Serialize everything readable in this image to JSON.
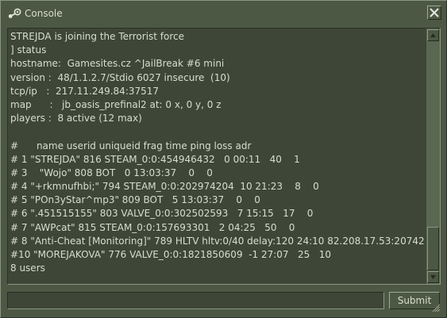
{
  "window": {
    "title": "Console",
    "colors": {
      "background": "#4c5844",
      "console_background": "#3e4637",
      "text": "#d8decf"
    }
  },
  "icons": {
    "title": "steam-icon",
    "close": "close-icon",
    "scroll_up": "arrow-up-icon",
    "scroll_down": "arrow-down-icon",
    "resize": "resize-grip-icon"
  },
  "console": {
    "lines": [
      "STREJDA is joining the Terrorist force",
      "] status",
      "hostname:  Gamesites.cz ^JailBreak #6 mini",
      "version :  48/1.1.2.7/Stdio 6027 insecure  (10)",
      "tcp/ip   :  217.11.249.84:37517",
      "map      :   jb_oasis_prefinal2 at: 0 x, 0 y, 0 z",
      "players :  8 active (12 max)",
      "",
      "#      name userid uniqueid frag time ping loss adr",
      "# 1 \"STREJDA\" 816 STEAM_0:0:454946432   0 00:11   40    1",
      "# 3    \"Wojo\" 808 BOT   0 13:03:37    0    0",
      "# 4 \"+rkmnufhbi;\" 794 STEAM_0:0:202974204  10 21:23    8    0",
      "# 5 \"POn3yStar^mp3\" 809 BOT   5 13:03:37    0    0",
      "# 6 \".451515155\" 803 VALVE_0:0:302502593   7 15:15   17    0",
      "# 7 \"AWPcat\" 815 STEAM_0:0:157693301   2 04:25   50    0",
      "# 8 \"Anti-Cheat [Monitoring]\" 789 HLTV hltv:0/40 delay:120 24:10 82.208.17.53:20742",
      "#10 \"MOREJAKOVA\" 776 VALVE_0:0:1821850609  -1 27:07   25   10",
      "8 users"
    ]
  },
  "command": {
    "value": "",
    "submit_label": "Submit"
  }
}
